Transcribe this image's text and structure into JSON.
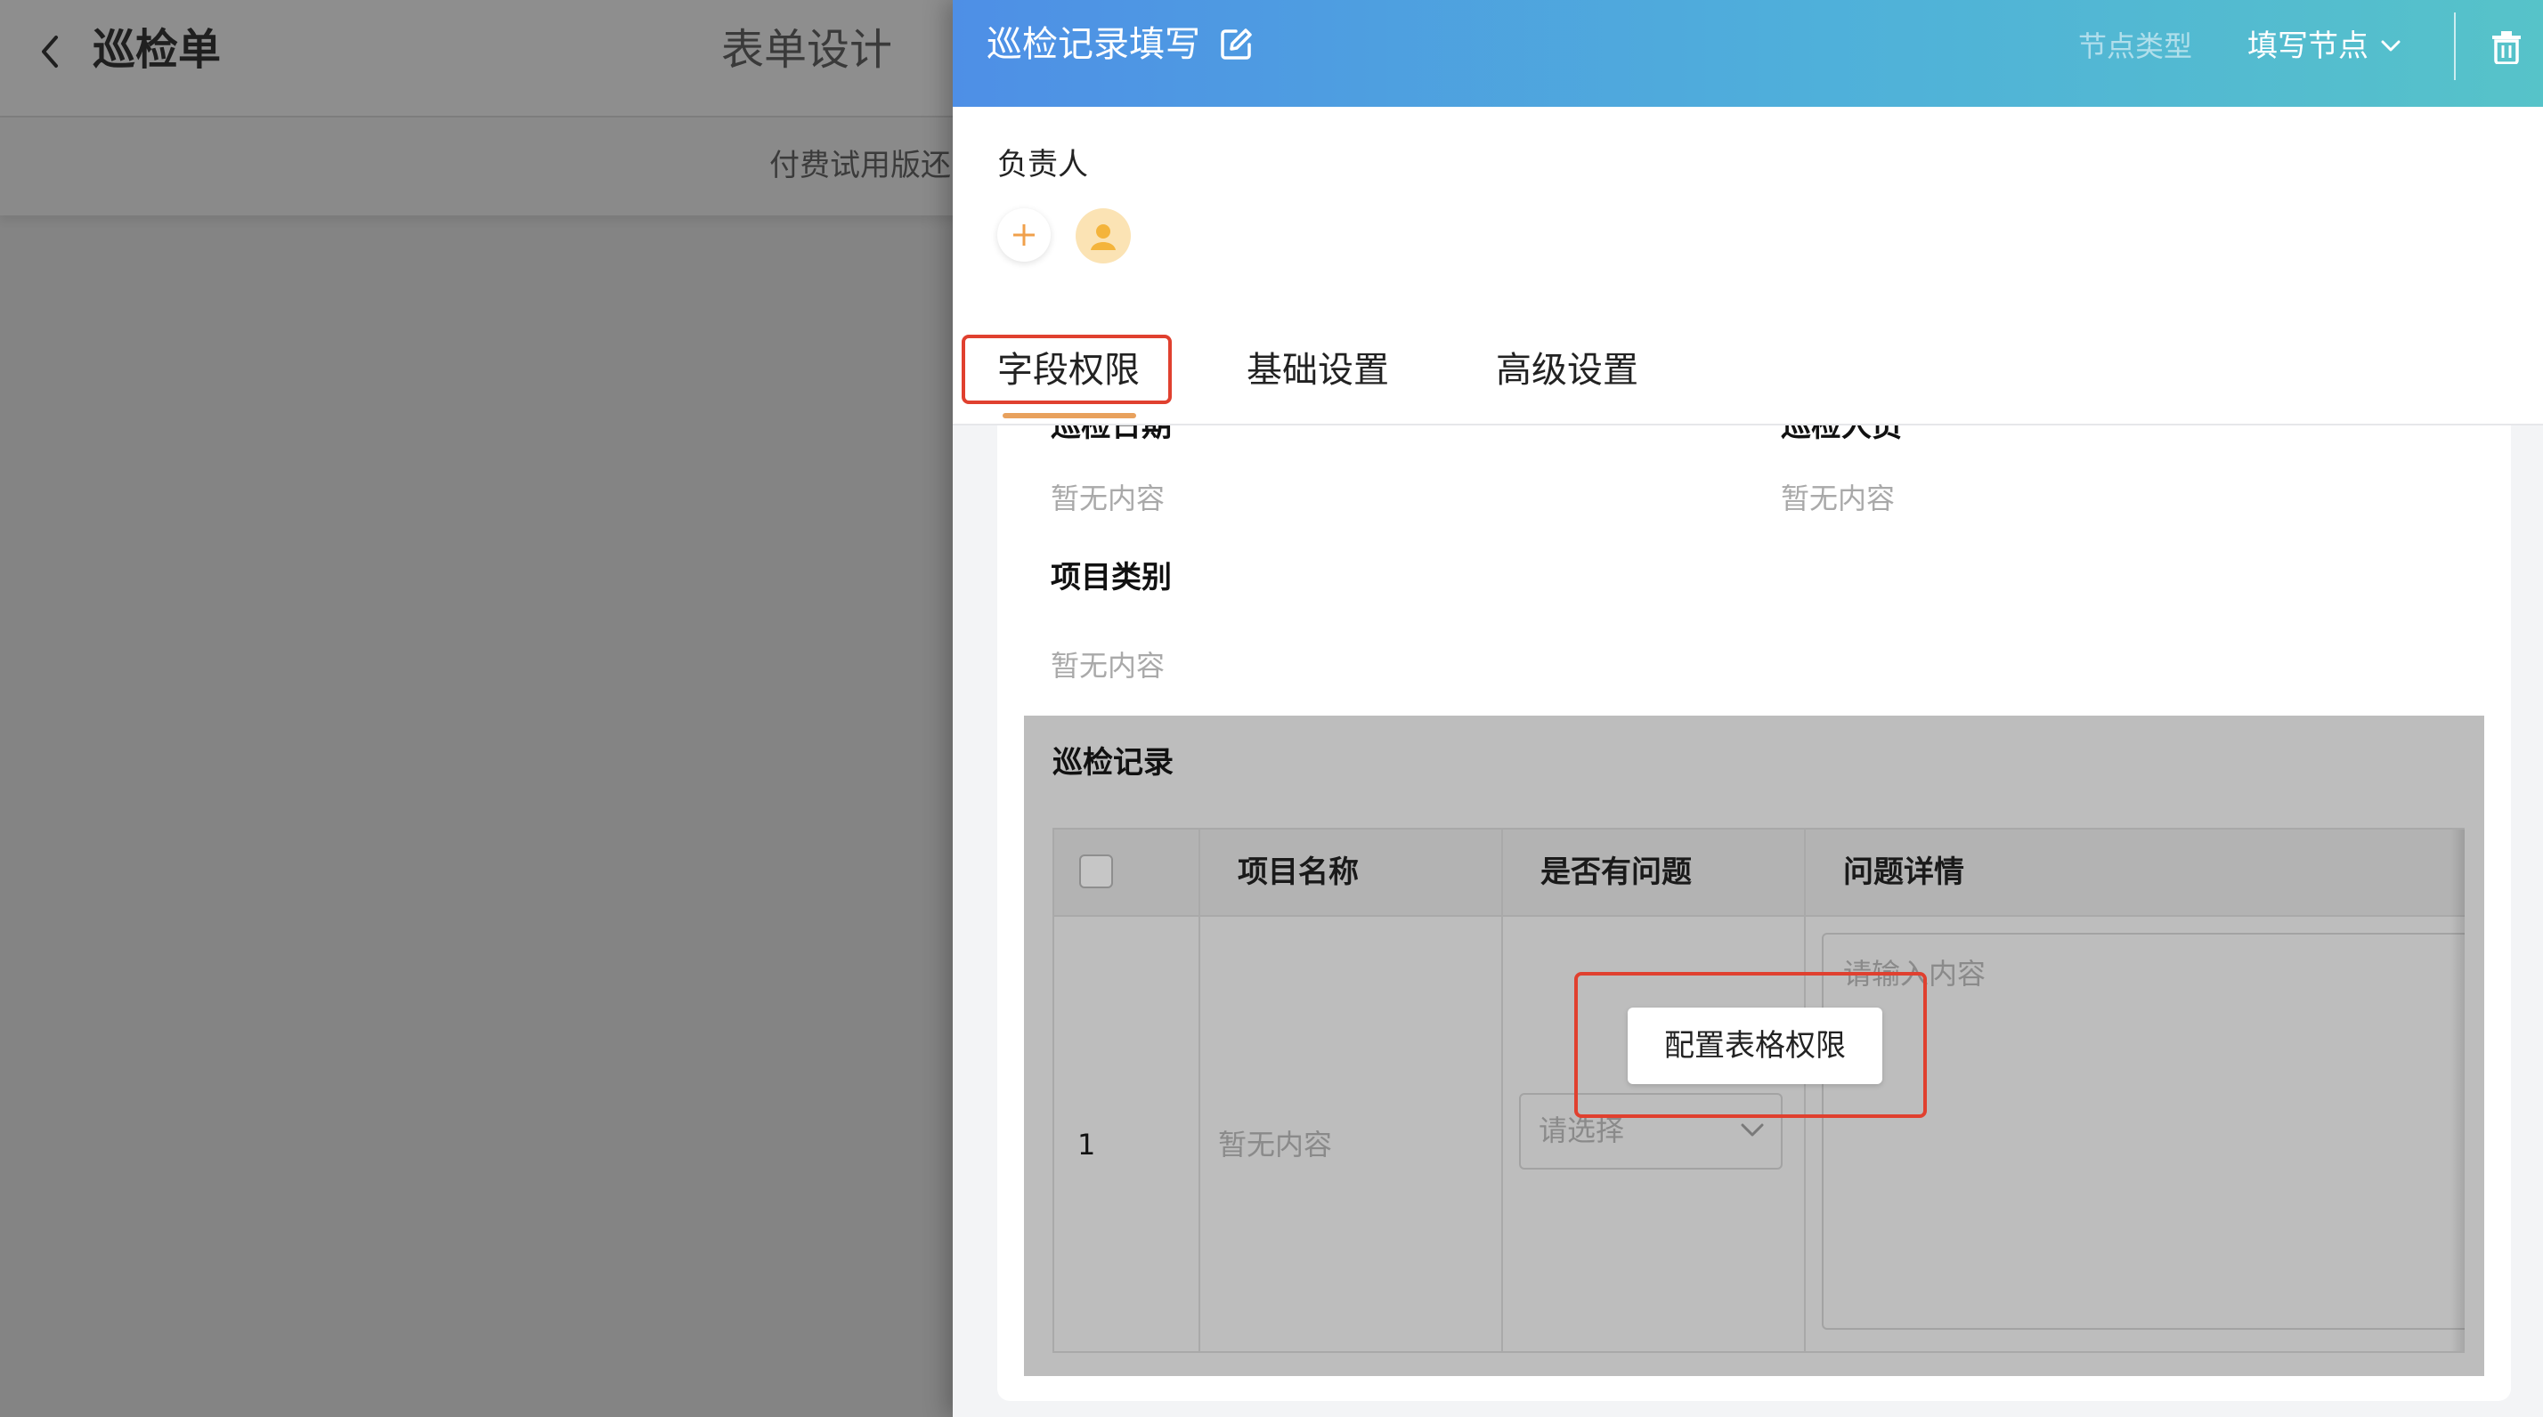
{
  "background_app": {
    "title": "巡检单",
    "tab": "表单设计",
    "trial_notice": "付费试用版还"
  },
  "drawer": {
    "title": "巡检记录填写",
    "node_type_label": "节点类型",
    "node_type_value": "填写节点",
    "owner_label": "负责人",
    "tabs": [
      "字段权限",
      "基础设置",
      "高级设置"
    ],
    "active_tab_index": 0
  },
  "form": {
    "fields": [
      {
        "label": "巡检日期",
        "value": "暂无内容"
      },
      {
        "label": "巡检人员",
        "value": "暂无内容"
      },
      {
        "label": "项目类别",
        "value": "暂无内容"
      }
    ],
    "table": {
      "title": "巡检记录",
      "columns": [
        "项目名称",
        "是否有问题",
        "问题详情"
      ],
      "rows": [
        {
          "index": "1",
          "name": "暂无内容",
          "select_placeholder": "请选择",
          "detail_placeholder": "请输入内容"
        }
      ]
    },
    "config_button": "配置表格权限"
  },
  "colors": {
    "header_gradient_start": "#4e8fe6",
    "header_gradient_end": "#56c3c9",
    "active_tab_underline": "#e8a15d",
    "highlight_box": "#e0402f",
    "add_icon": "#f0a04b"
  },
  "icons": [
    "back-chevron-icon",
    "edit-icon",
    "chevron-down-icon",
    "trash-icon",
    "plus-icon",
    "user-avatar-icon"
  ]
}
